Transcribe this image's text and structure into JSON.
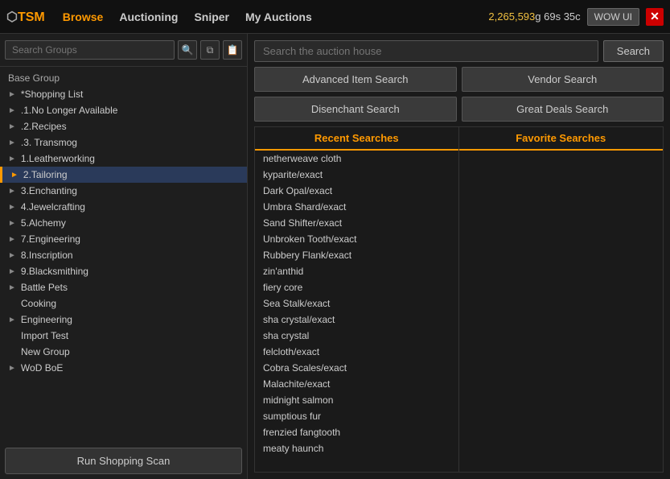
{
  "topbar": {
    "logo_prefix": "⬡TSM",
    "nav_items": [
      {
        "label": "Browse",
        "active": true
      },
      {
        "label": "Auctioning",
        "active": false
      },
      {
        "label": "Sniper",
        "active": false
      },
      {
        "label": "My Auctions",
        "active": false
      }
    ],
    "gold": "2,265,593",
    "gold_suffix": "g",
    "time": "69s 35c",
    "wow_ui_label": "WOW UI",
    "close_label": "✕"
  },
  "left": {
    "search_placeholder": "Search Groups",
    "group_header": "Base Group",
    "tree_items": [
      {
        "label": "*Shopping List",
        "indent": 0,
        "arrow": "►",
        "active": false
      },
      {
        "label": ".1.No Longer Available",
        "indent": 0,
        "arrow": "►",
        "active": false
      },
      {
        "label": ".2.Recipes",
        "indent": 0,
        "arrow": "►",
        "active": false
      },
      {
        "label": ".3. Transmog",
        "indent": 0,
        "arrow": "►",
        "active": false
      },
      {
        "label": "1.Leatherworking",
        "indent": 0,
        "arrow": "►",
        "active": false
      },
      {
        "label": "2.Tailoring",
        "indent": 0,
        "arrow": "►",
        "active": true
      },
      {
        "label": "3.Enchanting",
        "indent": 0,
        "arrow": "►",
        "active": false
      },
      {
        "label": "4.Jewelcrafting",
        "indent": 0,
        "arrow": "►",
        "active": false
      },
      {
        "label": "5.Alchemy",
        "indent": 0,
        "arrow": "►",
        "active": false
      },
      {
        "label": "7.Engineering",
        "indent": 0,
        "arrow": "►",
        "active": false
      },
      {
        "label": "8.Inscription",
        "indent": 0,
        "arrow": "►",
        "active": false
      },
      {
        "label": "9.Blacksmithing",
        "indent": 0,
        "arrow": "►",
        "active": false
      },
      {
        "label": "Battle Pets",
        "indent": 0,
        "arrow": "►",
        "active": false
      },
      {
        "label": "Cooking",
        "indent": 0,
        "arrow": "",
        "active": false
      },
      {
        "label": "Engineering",
        "indent": 0,
        "arrow": "►",
        "active": false
      },
      {
        "label": "Import Test",
        "indent": 0,
        "arrow": "",
        "active": false
      },
      {
        "label": "New Group",
        "indent": 0,
        "arrow": "",
        "active": false
      },
      {
        "label": "WoD BoE",
        "indent": 0,
        "arrow": "►",
        "active": false
      }
    ],
    "bottom_btn": "Run Shopping Scan"
  },
  "right": {
    "search_placeholder": "Search the auction house",
    "search_btn": "Search",
    "action_buttons": [
      "Advanced Item Search",
      "Vendor Search",
      "Disenchant Search",
      "Great Deals Search"
    ],
    "recent_header": "Recent Searches",
    "favorite_header": "Favorite Searches",
    "recent_searches": [
      "netherweave cloth",
      "kyparite/exact",
      "Dark Opal/exact",
      "Umbra Shard/exact",
      "Sand Shifter/exact",
      "Unbroken Tooth/exact",
      "Rubbery Flank/exact",
      "zin'anthid",
      "fiery core",
      "Sea Stalk/exact",
      "sha crystal/exact",
      "sha crystal",
      "felcloth/exact",
      "Cobra Scales/exact",
      "Malachite/exact",
      "midnight salmon",
      "sumptious fur",
      "frenzied fangtooth",
      "meaty haunch"
    ],
    "favorite_searches": []
  }
}
